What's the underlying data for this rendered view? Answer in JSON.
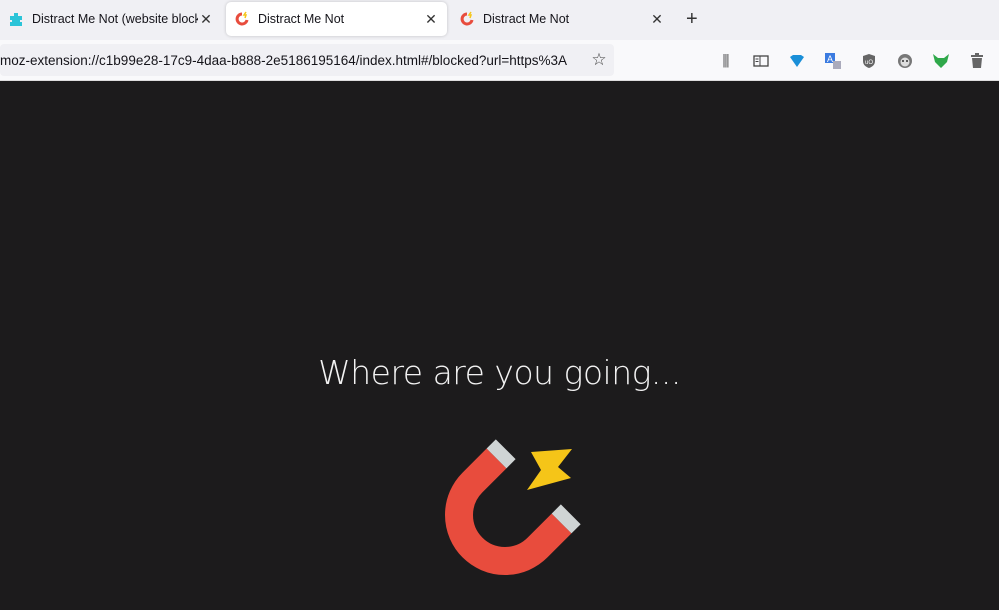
{
  "tabs": [
    {
      "label": "Distract Me Not (website blocker",
      "icon": "puzzle-icon",
      "active": false
    },
    {
      "label": "Distract Me Not",
      "icon": "magnet-icon",
      "active": true
    },
    {
      "label": "Distract Me Not",
      "icon": "magnet-icon",
      "active": false
    }
  ],
  "url": "moz-extension://c1b99e28-17c9-4daa-b888-2e5186195164/index.html#/blocked?url=https%3A",
  "toolbar_icons": [
    "library-icon",
    "sidebar-icon",
    "diamond-extension-icon",
    "translate-icon",
    "ublock-icon",
    "monkey-icon",
    "fox-extension-icon",
    "trash-icon"
  ],
  "page": {
    "heading": "Where are you going..."
  },
  "colors": {
    "background": "#1c1b1c",
    "magnet": "#e84c3d",
    "magnet_tips": "#cfd4d4",
    "bolt": "#f5c518"
  }
}
